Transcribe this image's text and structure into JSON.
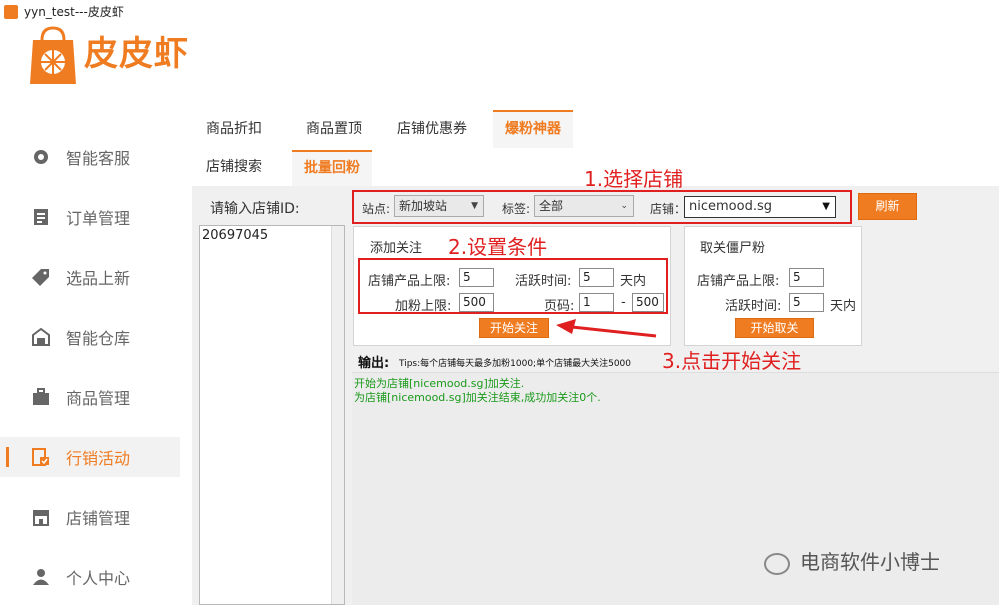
{
  "window": {
    "title": "yyn_test---皮皮虾"
  },
  "brand": {
    "name": "皮皮虾",
    "color": "#f07c22"
  },
  "sidebar": {
    "items": [
      {
        "label": "智能客服",
        "icon": "chat-bubble-icon"
      },
      {
        "label": "订单管理",
        "icon": "document-list-icon"
      },
      {
        "label": "选品上新",
        "icon": "tag-icon"
      },
      {
        "label": "智能仓库",
        "icon": "warehouse-icon"
      },
      {
        "label": "商品管理",
        "icon": "briefcase-icon"
      },
      {
        "label": "行销活动",
        "icon": "promo-icon",
        "active": true
      },
      {
        "label": "店铺管理",
        "icon": "store-icon"
      },
      {
        "label": "个人中心",
        "icon": "user-icon"
      }
    ]
  },
  "tabs": [
    {
      "label": "商品折扣"
    },
    {
      "label": "商品置顶"
    },
    {
      "label": "店铺优惠券"
    },
    {
      "label": "爆粉神器",
      "active": true
    }
  ],
  "subtabs": [
    {
      "label": "店铺搜索"
    },
    {
      "label": "批量回粉",
      "active": true
    }
  ],
  "shop_id": {
    "label": "请输入店铺ID:",
    "values": [
      "20697045"
    ]
  },
  "filters": {
    "site_label": "站点:",
    "site_value": "新加坡站",
    "tag_label": "标签:",
    "tag_value": "全部",
    "shop_label": "店铺：",
    "shop_value": "nicemood.sg",
    "refresh_label": "刷新"
  },
  "follow": {
    "title": "添加关注",
    "product_limit_label": "店铺产品上限:",
    "product_limit_value": "5",
    "active_time_label": "活跃时间:",
    "active_time_value": "5",
    "active_time_unit": "天内",
    "fans_limit_label": "加粉上限:",
    "fans_limit_value": "500",
    "page_label": "页码:",
    "page_from": "1",
    "page_sep": "-",
    "page_to": "500",
    "start_button": "开始关注"
  },
  "unfollow": {
    "title": "取关僵尸粉",
    "product_limit_label": "店铺产品上限:",
    "product_limit_value": "5",
    "active_time_label": "活跃时间:",
    "active_time_value": "5",
    "active_time_unit": "天内",
    "start_button": "开始取关"
  },
  "output": {
    "label": "输出:",
    "tips": "Tips:每个店铺每天最多加粉1000;单个店铺最大关注5000",
    "lines": [
      "开始为店铺[nicemood.sg]加关注.",
      "为店铺[nicemood.sg]加关注结束,成功加关注0个."
    ]
  },
  "annotations": {
    "step1": "1.选择店铺",
    "step2": "2.设置条件",
    "step3": "3.点击开始关注",
    "color": "#e02020"
  },
  "watermark": "电商软件小博士"
}
